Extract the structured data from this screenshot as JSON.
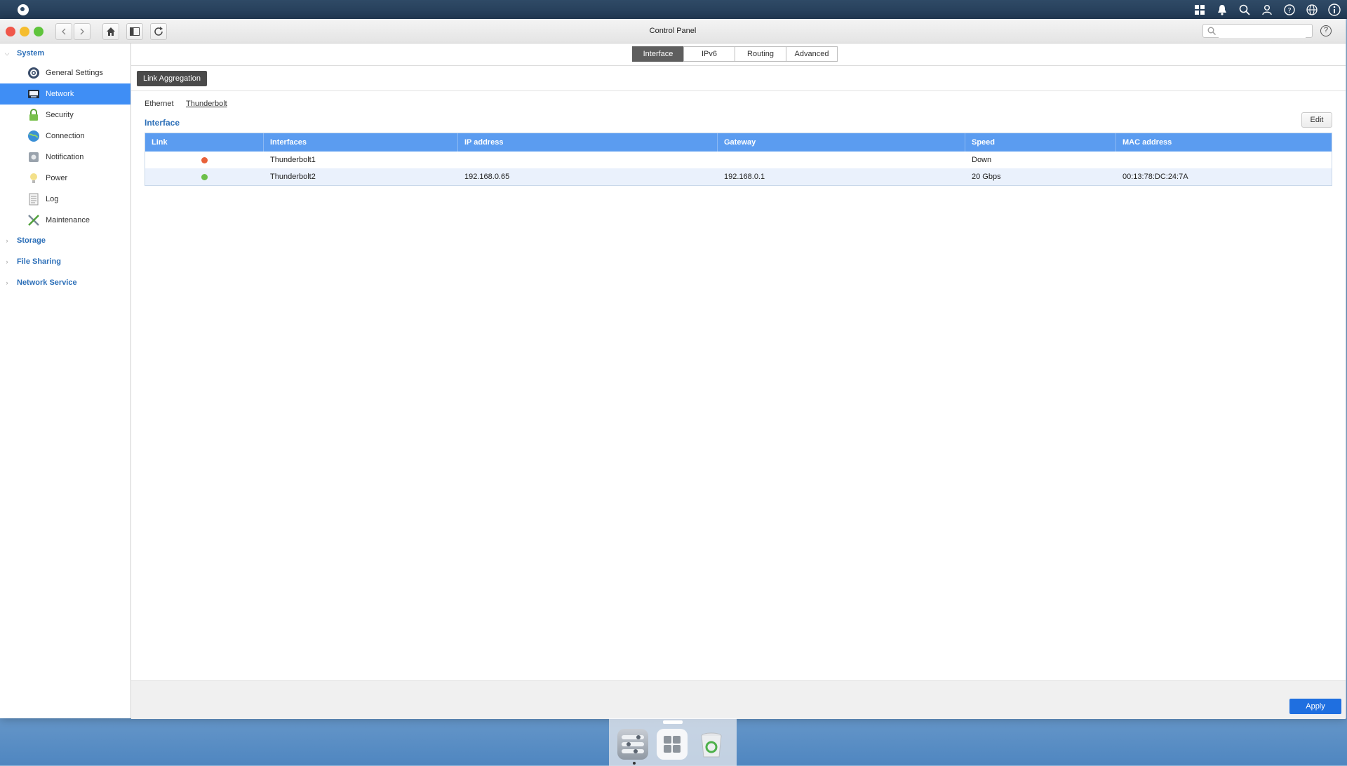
{
  "window": {
    "title": "Control Panel"
  },
  "search": {
    "placeholder": ""
  },
  "sidebar": {
    "sections": [
      {
        "label": "System"
      },
      {
        "label": "Storage"
      },
      {
        "label": "File Sharing"
      },
      {
        "label": "Network Service"
      }
    ],
    "items": [
      {
        "label": "General Settings",
        "icon": "gear-icon"
      },
      {
        "label": "Network",
        "icon": "network-icon"
      },
      {
        "label": "Security",
        "icon": "lock-icon"
      },
      {
        "label": "Connection",
        "icon": "globe-icon"
      },
      {
        "label": "Notification",
        "icon": "notification-icon"
      },
      {
        "label": "Power",
        "icon": "lightbulb-icon"
      },
      {
        "label": "Log",
        "icon": "log-icon"
      },
      {
        "label": "Maintenance",
        "icon": "wrench-icon"
      }
    ],
    "active_item": "Network"
  },
  "tabs": [
    {
      "label": "Interface"
    },
    {
      "label": "IPv6"
    },
    {
      "label": "Routing"
    },
    {
      "label": "Advanced"
    }
  ],
  "toolbar": {
    "link_aggregation": "Link Aggregation"
  },
  "subtabs": {
    "ethernet": "Ethernet",
    "thunderbolt": "Thunderbolt"
  },
  "section": {
    "title": "Interface",
    "edit_label": "Edit"
  },
  "table": {
    "headers": [
      "Link",
      "Interfaces",
      "IP address",
      "Gateway",
      "Speed",
      "MAC address"
    ],
    "rows": [
      {
        "link_status": "down",
        "link_color": "#e8613a",
        "interface": "Thunderbolt1",
        "ip": "",
        "gateway": "",
        "speed": "Down",
        "mac": ""
      },
      {
        "link_status": "up",
        "link_color": "#6cc04a",
        "interface": "Thunderbolt2",
        "ip": "192.168.0.65",
        "gateway": "192.168.0.1",
        "speed": "20 Gbps",
        "mac": "00:13:78:DC:24:7A"
      }
    ]
  },
  "footer": {
    "apply_label": "Apply"
  },
  "colors": {
    "accent": "#3f8ef5",
    "header_blue": "#5b9cf0",
    "section_blue": "#2c6fb8",
    "apply_blue": "#1f6fe0"
  }
}
